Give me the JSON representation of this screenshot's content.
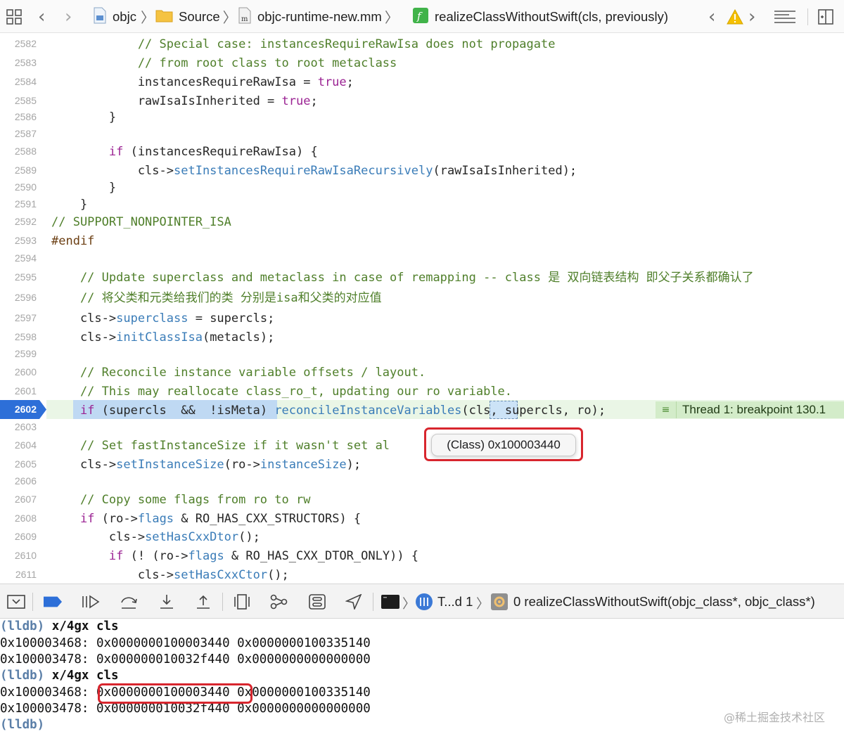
{
  "jumpbar": {
    "crumbs": [
      {
        "label": "objc",
        "icon": "project-icon"
      },
      {
        "label": "Source",
        "icon": "folder-icon"
      },
      {
        "label": "objc-runtime-new.mm",
        "icon": "mm-file-icon"
      },
      {
        "label": "realizeClassWithoutSwift(cls, previously)",
        "icon": "function-icon"
      }
    ],
    "colors": {
      "folder": "#f5c342",
      "function_badge": "#41b34a",
      "warning": "#f5c000"
    }
  },
  "editor": {
    "lines": [
      {
        "num": "2582",
        "code": "            // Special case: instancesRequireRawIsa does not propagate"
      },
      {
        "num": "2583",
        "code": "            // from root class to root metaclass"
      },
      {
        "num": "2584",
        "code": "            instancesRequireRawIsa = true;"
      },
      {
        "num": "2585",
        "code": "            rawIsaIsInherited = true;"
      },
      {
        "num": "2586",
        "code": "        }"
      },
      {
        "num": "2587",
        "code": ""
      },
      {
        "num": "2588",
        "code": "        if (instancesRequireRawIsa) {"
      },
      {
        "num": "2589",
        "code": "            cls->setInstancesRequireRawIsaRecursively(rawIsaIsInherited);"
      },
      {
        "num": "2590",
        "code": "        }"
      },
      {
        "num": "2591",
        "code": "    }"
      },
      {
        "num": "2592",
        "code": "// SUPPORT_NONPOINTER_ISA"
      },
      {
        "num": "2593",
        "code": "#endif"
      },
      {
        "num": "2594",
        "code": ""
      },
      {
        "num": "2595",
        "code": "    // Update superclass and metaclass in case of remapping -- class 是 双向链表结构 即父子关系都确认了"
      },
      {
        "num": "2596",
        "code": "    // 将父类和元类给我们的类 分别是isa和父类的对应值"
      },
      {
        "num": "2597",
        "code": "    cls->superclass = supercls;"
      },
      {
        "num": "2598",
        "code": "    cls->initClassIsa(metacls);"
      },
      {
        "num": "2599",
        "code": ""
      },
      {
        "num": "2600",
        "code": "    // Reconcile instance variable offsets / layout."
      },
      {
        "num": "2601",
        "code": "    // This may reallocate class_ro_t, updating our ro variable."
      },
      {
        "num": "2602",
        "code": "    if (supercls  &&  !isMeta) reconcileInstanceVariables(cls, supercls, ro);"
      },
      {
        "num": "2603",
        "code": ""
      },
      {
        "num": "2604",
        "code": "    // Set fastInstanceSize if it wasn't set al"
      },
      {
        "num": "2605",
        "code": "    cls->setInstanceSize(ro->instanceSize);"
      },
      {
        "num": "2606",
        "code": ""
      },
      {
        "num": "2607",
        "code": "    // Copy some flags from ro to rw"
      },
      {
        "num": "2608",
        "code": "    if (ro->flags & RO_HAS_CXX_STRUCTORS) {"
      },
      {
        "num": "2609",
        "code": "        cls->setHasCxxDtor();"
      },
      {
        "num": "2610",
        "code": "        if (! (ro->flags & RO_HAS_CXX_DTOR_ONLY)) {"
      },
      {
        "num": "2611",
        "code": "            cls->setHasCxxCtor();"
      }
    ],
    "current_line": "2602",
    "thread_badge": "Thread 1: breakpoint 130.1",
    "tooltip": "(Class) 0x100003440",
    "colors": {
      "current_line_bg": "#eaf6e6",
      "breakpoint": "#2d6fd8",
      "annotation_box": "#d8262e"
    }
  },
  "debugbar": {
    "thread_label": "T...d 1",
    "frame_label": "0 realizeClassWithoutSwift(objc_class*, objc_class*)"
  },
  "console": {
    "lines": [
      {
        "prompt": "(lldb)",
        "cmd": " x/4gx cls"
      },
      {
        "text": "0x100003468: 0x0000000100003440 0x0000000100335140"
      },
      {
        "text": "0x100003478: 0x000000010032f440 0x0000000000000000"
      },
      {
        "prompt": "(lldb)",
        "cmd": " x/4gx cls"
      },
      {
        "text": "0x100003468: 0x0000000100003440 0x0000000100335140"
      },
      {
        "text": "0x100003478: 0x000000010032f440 0x0000000000000000"
      },
      {
        "prompt": "(lldb)",
        "cmd": ""
      }
    ],
    "watermark": "@稀土掘金技术社区"
  }
}
